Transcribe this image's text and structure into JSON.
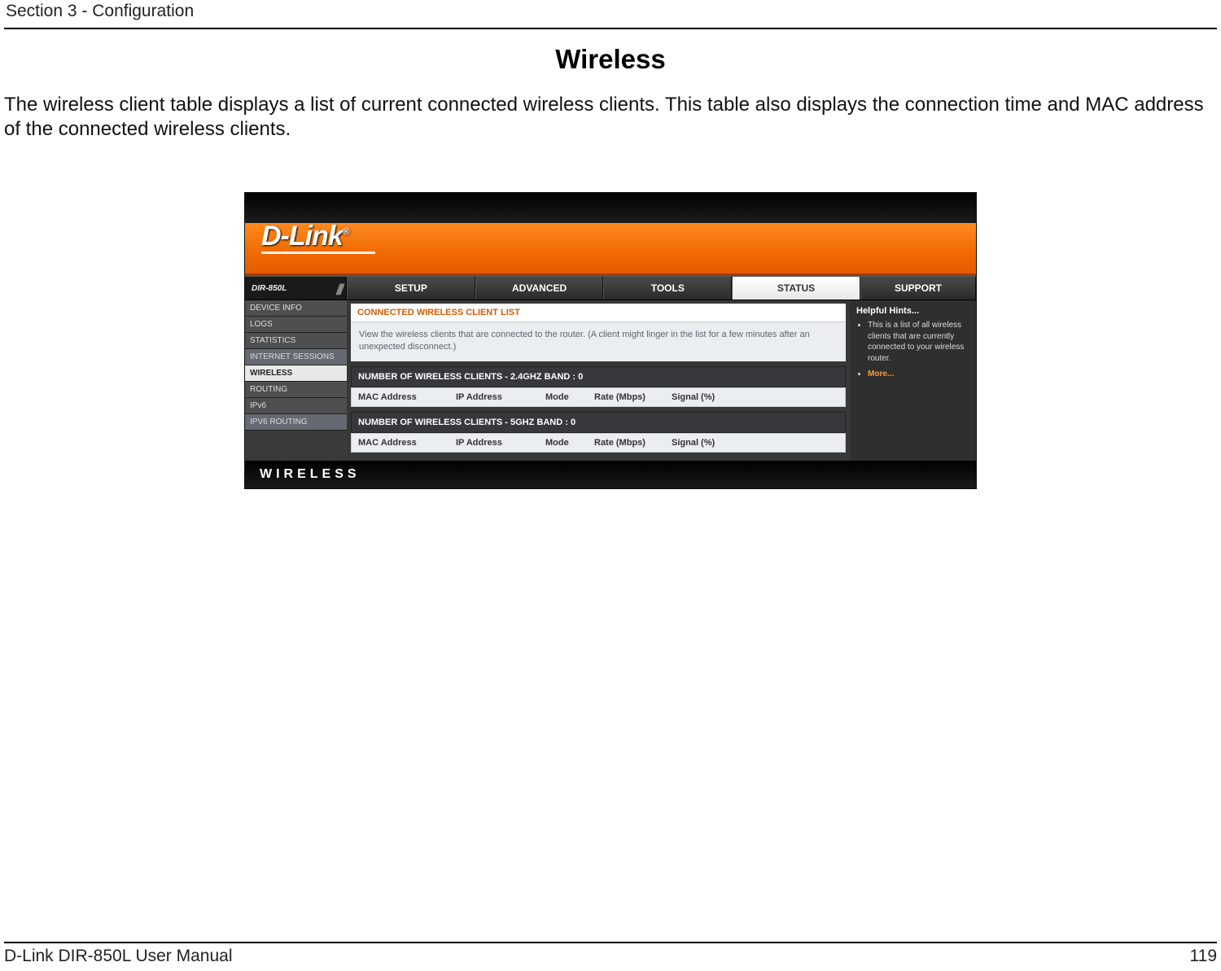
{
  "doc": {
    "section": "Section 3 - Configuration",
    "title": "Wireless",
    "intro": "The wireless client table displays a list of current connected wireless clients. This table also displays the connection time and MAC address of the connected wireless clients.",
    "footer_left": "D-Link DIR-850L User Manual",
    "footer_right": "119"
  },
  "router": {
    "brand": "D-Link",
    "model": "DIR-850L",
    "tabs": {
      "setup": "SETUP",
      "advanced": "ADVANCED",
      "tools": "TOOLS",
      "status": "STATUS",
      "support": "SUPPORT"
    },
    "sidebar": {
      "items": [
        {
          "label": "DEVICE INFO"
        },
        {
          "label": "LOGS"
        },
        {
          "label": "STATISTICS"
        },
        {
          "label": "INTERNET SESSIONS"
        },
        {
          "label": "WIRELESS"
        },
        {
          "label": "ROUTING"
        },
        {
          "label": "IPv6"
        },
        {
          "label": "IPV6 ROUTING"
        }
      ]
    },
    "content": {
      "panel_title": "CONNECTED WIRELESS CLIENT LIST",
      "panel_desc": "View the wireless clients that are connected to the router. (A client might linger in the list for a few minutes after an unexpected disconnect.)",
      "band24_header": "NUMBER OF WIRELESS CLIENTS - 2.4GHZ BAND : 0",
      "band5_header": "NUMBER OF WIRELESS CLIENTS - 5GHZ BAND : 0",
      "cols": {
        "mac": "MAC Address",
        "ip": "IP Address",
        "mode": "Mode",
        "rate": "Rate (Mbps)",
        "signal": "Signal (%)"
      }
    },
    "hints": {
      "title": "Helpful Hints...",
      "bullet1": "This is a list of all wireless clients that are currently connected to your wireless router.",
      "more": "More..."
    },
    "footer_word": "WIRELESS"
  }
}
